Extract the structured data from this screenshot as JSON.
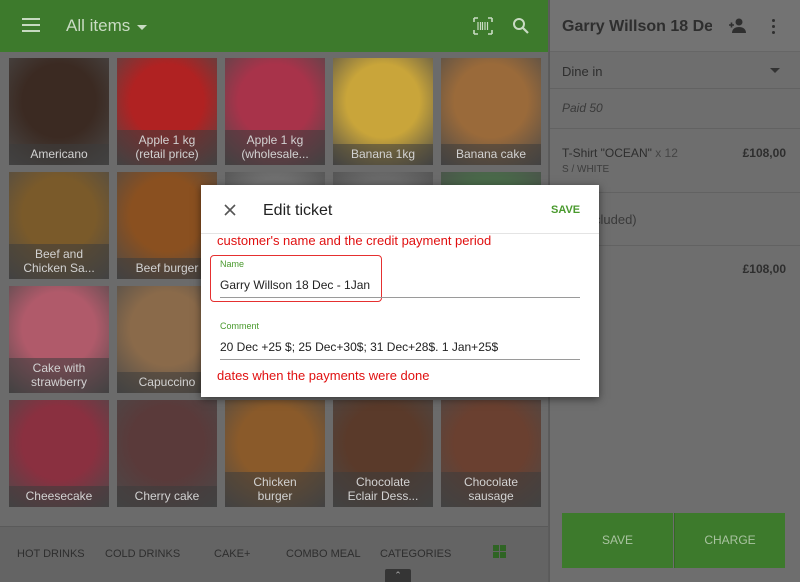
{
  "header": {
    "title": "All items"
  },
  "tiles": [
    {
      "label": "Americano",
      "color": "#3b2a22"
    },
    {
      "label": "Apple 1 kg\n(retail price)",
      "color": "#b02222"
    },
    {
      "label": "Apple 1 kg\n(wholesale...",
      "color": "#a8334a"
    },
    {
      "label": "Banana 1kg",
      "color": "#c9a53a"
    },
    {
      "label": "Banana cake",
      "color": "#9a6a3a"
    },
    {
      "label": "Beef and\nChicken Sa...",
      "color": "#7a5a2a"
    },
    {
      "label": "Beef burger",
      "color": "#8a5020"
    },
    {
      "label": "",
      "color": "#707070"
    },
    {
      "label": "",
      "color": "#6a6a6a"
    },
    {
      "label": "",
      "color": "#4a6a4a"
    },
    {
      "label": "Cake with\nstrawberry",
      "color": "#b05a6a"
    },
    {
      "label": "Capuccino",
      "color": "#8a6a4a"
    },
    {
      "label": "",
      "color": "#6a6a6a"
    },
    {
      "label": "",
      "color": "#6a6a6a"
    },
    {
      "label": "",
      "color": "#6a6a6a"
    },
    {
      "label": "Cheesecake",
      "color": "#8a3040"
    },
    {
      "label": "Cherry cake",
      "color": "#5a3a3a"
    },
    {
      "label": "Chicken\nburger",
      "color": "#8a5a2a"
    },
    {
      "label": "Chocolate\nEclair Dess...",
      "color": "#5a3a2a"
    },
    {
      "label": "Chocolate\nsausage",
      "color": "#6a4030"
    }
  ],
  "bottom_nav": [
    "HOT DRINKS",
    "COLD DRINKS",
    "CAKE+",
    "COMBO MEAL",
    "CATEGORIES"
  ],
  "ticket": {
    "customer": "Garry Willson 18 De...",
    "dining_option": "Dine in",
    "paid_note": "Paid 50",
    "item_name": "T-Shirt \"OCEAN\"",
    "item_qty": "x 12",
    "item_variant": "S / WHITE",
    "item_price": "£108,00",
    "tax_note": "cluded)",
    "total": "£108,00",
    "save_label": "SAVE",
    "charge_label": "CHARGE"
  },
  "dialog": {
    "title": "Edit ticket",
    "save_label": "SAVE",
    "annotation_top": "customer's name and the credit payment period",
    "name_label": "Name",
    "name_value": "Garry Willson 18 Dec - 1Jan",
    "comment_label": "Comment",
    "comment_value": "20 Dec +25 $; 25 Dec+30$; 31 Dec+28$. 1 Jan+25$",
    "annotation_bottom": "dates when the payments were done"
  },
  "colors": {
    "accent": "#3d7a2c",
    "annotation": "#e01010"
  }
}
